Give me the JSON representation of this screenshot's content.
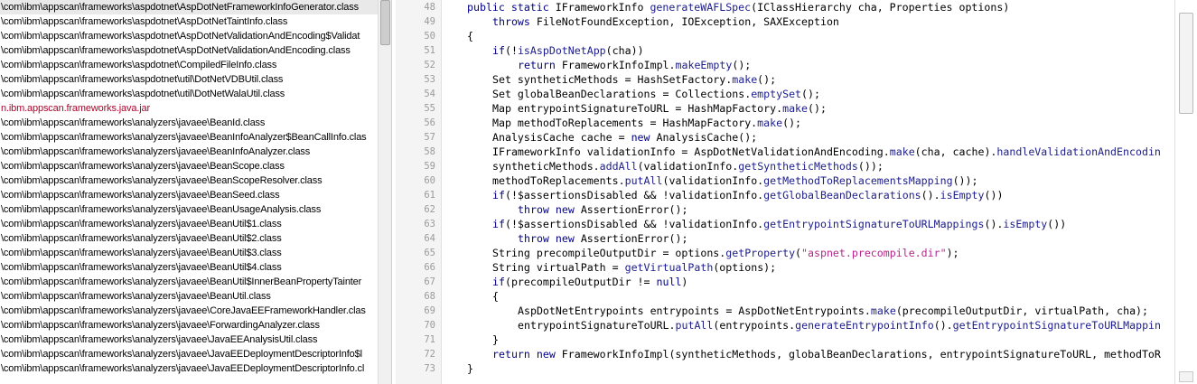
{
  "file_list": [
    {
      "text": "\\com\\ibm\\appscan\\frameworks\\aspdotnet\\AspDotNetFrameworkInfoGenerator.class",
      "kind": "file",
      "selected": true
    },
    {
      "text": "\\com\\ibm\\appscan\\frameworks\\aspdotnet\\AspDotNetTaintInfo.class",
      "kind": "file"
    },
    {
      "text": "\\com\\ibm\\appscan\\frameworks\\aspdotnet\\AspDotNetValidationAndEncoding$Validat",
      "kind": "file"
    },
    {
      "text": "\\com\\ibm\\appscan\\frameworks\\aspdotnet\\AspDotNetValidationAndEncoding.class",
      "kind": "file"
    },
    {
      "text": "\\com\\ibm\\appscan\\frameworks\\aspdotnet\\CompiledFileInfo.class",
      "kind": "file"
    },
    {
      "text": "\\com\\ibm\\appscan\\frameworks\\aspdotnet\\util\\DotNetVDBUtil.class",
      "kind": "file"
    },
    {
      "text": "\\com\\ibm\\appscan\\frameworks\\aspdotnet\\util\\DotNetWalaUtil.class",
      "kind": "file"
    },
    {
      "text": "n.ibm.appscan.frameworks.java.jar",
      "kind": "jar"
    },
    {
      "text": "\\com\\ibm\\appscan\\frameworks\\analyzers\\javaee\\BeanId.class",
      "kind": "file"
    },
    {
      "text": "\\com\\ibm\\appscan\\frameworks\\analyzers\\javaee\\BeanInfoAnalyzer$BeanCallInfo.clas",
      "kind": "file"
    },
    {
      "text": "\\com\\ibm\\appscan\\frameworks\\analyzers\\javaee\\BeanInfoAnalyzer.class",
      "kind": "file"
    },
    {
      "text": "\\com\\ibm\\appscan\\frameworks\\analyzers\\javaee\\BeanScope.class",
      "kind": "file"
    },
    {
      "text": "\\com\\ibm\\appscan\\frameworks\\analyzers\\javaee\\BeanScopeResolver.class",
      "kind": "file"
    },
    {
      "text": "\\com\\ibm\\appscan\\frameworks\\analyzers\\javaee\\BeanSeed.class",
      "kind": "file"
    },
    {
      "text": "\\com\\ibm\\appscan\\frameworks\\analyzers\\javaee\\BeanUsageAnalysis.class",
      "kind": "file"
    },
    {
      "text": "\\com\\ibm\\appscan\\frameworks\\analyzers\\javaee\\BeanUtil$1.class",
      "kind": "file"
    },
    {
      "text": "\\com\\ibm\\appscan\\frameworks\\analyzers\\javaee\\BeanUtil$2.class",
      "kind": "file"
    },
    {
      "text": "\\com\\ibm\\appscan\\frameworks\\analyzers\\javaee\\BeanUtil$3.class",
      "kind": "file"
    },
    {
      "text": "\\com\\ibm\\appscan\\frameworks\\analyzers\\javaee\\BeanUtil$4.class",
      "kind": "file"
    },
    {
      "text": "\\com\\ibm\\appscan\\frameworks\\analyzers\\javaee\\BeanUtil$InnerBeanPropertyTainter",
      "kind": "file"
    },
    {
      "text": "\\com\\ibm\\appscan\\frameworks\\analyzers\\javaee\\BeanUtil.class",
      "kind": "file"
    },
    {
      "text": "\\com\\ibm\\appscan\\frameworks\\analyzers\\javaee\\CoreJavaEEFrameworkHandler.clas",
      "kind": "file"
    },
    {
      "text": "\\com\\ibm\\appscan\\frameworks\\analyzers\\javaee\\ForwardingAnalyzer.class",
      "kind": "file"
    },
    {
      "text": "\\com\\ibm\\appscan\\frameworks\\analyzers\\javaee\\JavaEEAnalysisUtil.class",
      "kind": "file"
    },
    {
      "text": "\\com\\ibm\\appscan\\frameworks\\analyzers\\javaee\\JavaEEDeploymentDescriptorInfo$l",
      "kind": "file"
    },
    {
      "text": "\\com\\ibm\\appscan\\frameworks\\analyzers\\javaee\\JavaEEDeploymentDescriptorInfo.cl",
      "kind": "file"
    }
  ],
  "code_lines": [
    {
      "n": "48",
      "indent": 4,
      "tokens": [
        [
          "kw",
          "public static "
        ],
        [
          "ty",
          "IFrameworkInfo "
        ],
        [
          "mt",
          "generateWAFLSpec"
        ],
        [
          "ty",
          "(IClassHierarchy cha, Properties options)"
        ]
      ]
    },
    {
      "n": "49",
      "indent": 8,
      "tokens": [
        [
          "kw",
          "throws "
        ],
        [
          "ty",
          "FileNotFoundException, IOException, SAXException"
        ]
      ]
    },
    {
      "n": "50",
      "indent": 4,
      "tokens": [
        [
          "ty",
          "{"
        ]
      ]
    },
    {
      "n": "51",
      "indent": 8,
      "tokens": [
        [
          "kw",
          "if"
        ],
        [
          "ty",
          "(!"
        ],
        [
          "mt",
          "isAspDotNetApp"
        ],
        [
          "ty",
          "(cha))"
        ]
      ]
    },
    {
      "n": "52",
      "indent": 12,
      "tokens": [
        [
          "kw",
          "return "
        ],
        [
          "ty",
          "FrameworkInfoImpl."
        ],
        [
          "mt",
          "makeEmpty"
        ],
        [
          "ty",
          "();"
        ]
      ]
    },
    {
      "n": "53",
      "indent": 8,
      "tokens": [
        [
          "ty",
          "Set syntheticMethods = HashSetFactory."
        ],
        [
          "mt",
          "make"
        ],
        [
          "ty",
          "();"
        ]
      ]
    },
    {
      "n": "54",
      "indent": 8,
      "tokens": [
        [
          "ty",
          "Set globalBeanDeclarations = Collections."
        ],
        [
          "mt",
          "emptySet"
        ],
        [
          "ty",
          "();"
        ]
      ]
    },
    {
      "n": "55",
      "indent": 8,
      "tokens": [
        [
          "ty",
          "Map entrypointSignatureToURL = HashMapFactory."
        ],
        [
          "mt",
          "make"
        ],
        [
          "ty",
          "();"
        ]
      ]
    },
    {
      "n": "56",
      "indent": 8,
      "tokens": [
        [
          "ty",
          "Map methodToReplacements = HashMapFactory."
        ],
        [
          "mt",
          "make"
        ],
        [
          "ty",
          "();"
        ]
      ]
    },
    {
      "n": "57",
      "indent": 8,
      "tokens": [
        [
          "ty",
          "AnalysisCache cache = "
        ],
        [
          "kw",
          "new "
        ],
        [
          "ty",
          "AnalysisCache();"
        ]
      ]
    },
    {
      "n": "58",
      "indent": 8,
      "tokens": [
        [
          "ty",
          "IFrameworkInfo validationInfo = AspDotNetValidationAndEncoding."
        ],
        [
          "mt",
          "make"
        ],
        [
          "ty",
          "(cha, cache)."
        ],
        [
          "mt",
          "handleValidationAndEncodin"
        ]
      ]
    },
    {
      "n": "59",
      "indent": 8,
      "tokens": [
        [
          "ty",
          "syntheticMethods."
        ],
        [
          "mt",
          "addAll"
        ],
        [
          "ty",
          "(validationInfo."
        ],
        [
          "mt",
          "getSyntheticMethods"
        ],
        [
          "ty",
          "());"
        ]
      ]
    },
    {
      "n": "60",
      "indent": 8,
      "tokens": [
        [
          "ty",
          "methodToReplacements."
        ],
        [
          "mt",
          "putAll"
        ],
        [
          "ty",
          "(validationInfo."
        ],
        [
          "mt",
          "getMethodToReplacementsMapping"
        ],
        [
          "ty",
          "());"
        ]
      ]
    },
    {
      "n": "61",
      "indent": 8,
      "tokens": [
        [
          "kw",
          "if"
        ],
        [
          "ty",
          "(!$assertionsDisabled && !validationInfo."
        ],
        [
          "mt",
          "getGlobalBeanDeclarations"
        ],
        [
          "ty",
          "()."
        ],
        [
          "mt",
          "isEmpty"
        ],
        [
          "ty",
          "())"
        ]
      ]
    },
    {
      "n": "62",
      "indent": 12,
      "tokens": [
        [
          "kw",
          "throw new "
        ],
        [
          "ty",
          "AssertionError();"
        ]
      ]
    },
    {
      "n": "63",
      "indent": 8,
      "tokens": [
        [
          "kw",
          "if"
        ],
        [
          "ty",
          "(!$assertionsDisabled && !validationInfo."
        ],
        [
          "mt",
          "getEntrypointSignatureToURLMappings"
        ],
        [
          "ty",
          "()."
        ],
        [
          "mt",
          "isEmpty"
        ],
        [
          "ty",
          "())"
        ]
      ]
    },
    {
      "n": "64",
      "indent": 12,
      "tokens": [
        [
          "kw",
          "throw new "
        ],
        [
          "ty",
          "AssertionError();"
        ]
      ]
    },
    {
      "n": "65",
      "indent": 8,
      "tokens": [
        [
          "ty",
          "String precompileOutputDir = options."
        ],
        [
          "mt",
          "getProperty"
        ],
        [
          "ty",
          "("
        ],
        [
          "st",
          "\"aspnet.precompile.dir\""
        ],
        [
          "ty",
          ");"
        ]
      ]
    },
    {
      "n": "66",
      "indent": 8,
      "tokens": [
        [
          "ty",
          "String virtualPath = "
        ],
        [
          "mt",
          "getVirtualPath"
        ],
        [
          "ty",
          "(options);"
        ]
      ]
    },
    {
      "n": "67",
      "indent": 8,
      "tokens": [
        [
          "kw",
          "if"
        ],
        [
          "ty",
          "(precompileOutputDir != "
        ],
        [
          "kw",
          "null"
        ],
        [
          "ty",
          ")"
        ]
      ]
    },
    {
      "n": "68",
      "indent": 8,
      "tokens": [
        [
          "ty",
          "{"
        ]
      ]
    },
    {
      "n": "69",
      "indent": 12,
      "tokens": [
        [
          "ty",
          "AspDotNetEntrypoints entrypoints = AspDotNetEntrypoints."
        ],
        [
          "mt",
          "make"
        ],
        [
          "ty",
          "(precompileOutputDir, virtualPath, cha);"
        ]
      ]
    },
    {
      "n": "70",
      "indent": 12,
      "tokens": [
        [
          "ty",
          "entrypointSignatureToURL."
        ],
        [
          "mt",
          "putAll"
        ],
        [
          "ty",
          "(entrypoints."
        ],
        [
          "mt",
          "generateEntrypointInfo"
        ],
        [
          "ty",
          "()."
        ],
        [
          "mt",
          "getEntrypointSignatureToURLMappin"
        ]
      ]
    },
    {
      "n": "71",
      "indent": 8,
      "tokens": [
        [
          "ty",
          "}"
        ]
      ]
    },
    {
      "n": "72",
      "indent": 8,
      "tokens": [
        [
          "kw",
          "return new "
        ],
        [
          "ty",
          "FrameworkInfoImpl(syntheticMethods, globalBeanDeclarations, entrypointSignatureToURL, methodToR"
        ]
      ]
    },
    {
      "n": "73",
      "indent": 4,
      "tokens": [
        [
          "ty",
          "}"
        ]
      ]
    }
  ],
  "colors": {
    "keyword": "#00008b",
    "method": "#1c1c8c",
    "string": "#b5258d",
    "jar": "#b0002a",
    "line_number": "#9a9a9a"
  }
}
